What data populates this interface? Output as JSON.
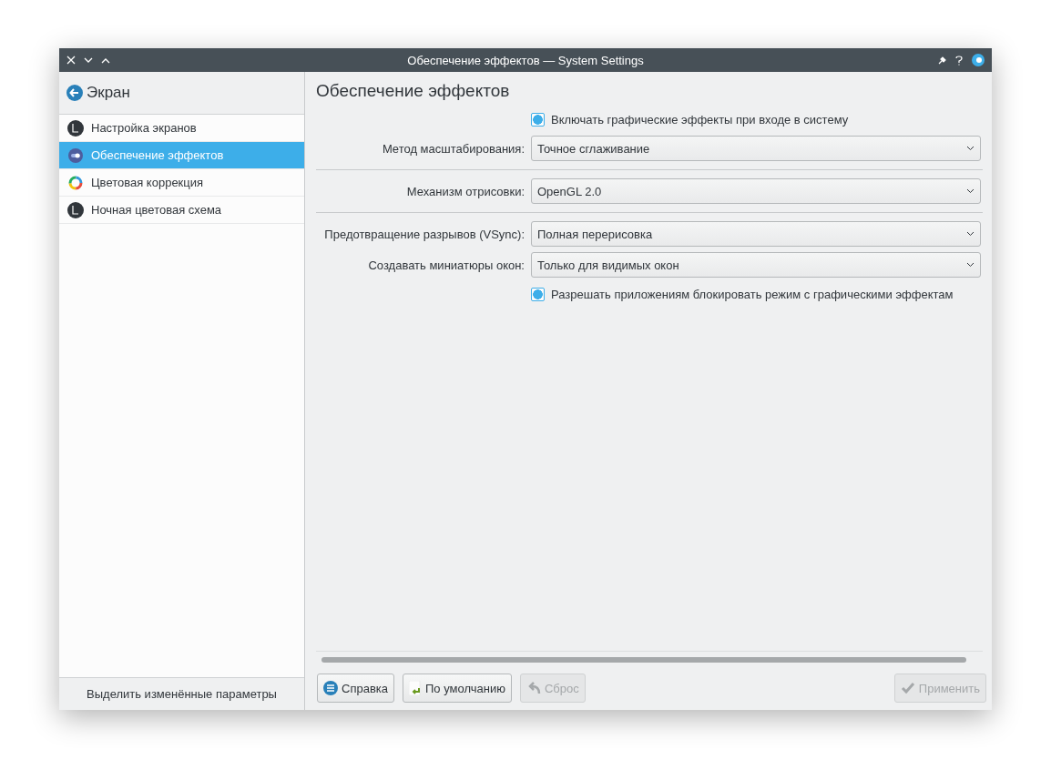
{
  "window": {
    "title": "Обеспечение эффектов — System Settings"
  },
  "sidebar": {
    "back_label": "Экран",
    "items": [
      {
        "label": "Настройка экранов",
        "selected": false
      },
      {
        "label": "Обеспечение эффектов",
        "selected": true
      },
      {
        "label": "Цветовая коррекция",
        "selected": false
      },
      {
        "label": "Ночная цветовая схема",
        "selected": false
      }
    ],
    "footer": "Выделить изменённые параметры"
  },
  "page": {
    "title": "Обеспечение эффектов",
    "rows": [
      {
        "kind": "checkbox",
        "label": "Включать графические эффекты при входе в систему",
        "checked": true,
        "separator": false
      },
      {
        "kind": "combo",
        "label": "Метод масштабирования:",
        "value": "Точное сглаживание",
        "separator": true
      },
      {
        "kind": "combo",
        "label": "Механизм отрисовки:",
        "value": "OpenGL 2.0",
        "separator": true
      },
      {
        "kind": "combo",
        "label": "Предотвращение разрывов (VSync):",
        "value": "Полная перерисовка",
        "separator": false
      },
      {
        "kind": "combo",
        "label": "Создавать миниатюры окон:",
        "value": "Только для видимых окон",
        "separator": false
      },
      {
        "kind": "checkbox",
        "label": "Разрешать приложениям блокировать режим с графическими эффектам",
        "checked": true,
        "separator": false
      }
    ]
  },
  "buttons": [
    {
      "label": "Справка",
      "disabled": false
    },
    {
      "label": "По умолчанию",
      "disabled": false
    },
    {
      "label": "Сброс",
      "disabled": true
    },
    {
      "label": "Применить",
      "disabled": true
    }
  ]
}
